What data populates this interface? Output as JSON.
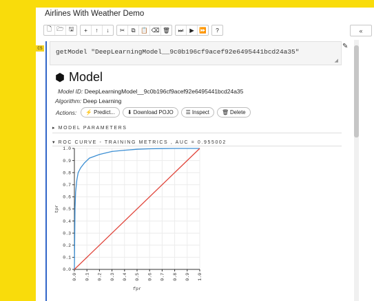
{
  "notebook": {
    "title": "Airlines With Weather Demo"
  },
  "toolbar": {
    "groups": [
      [
        "new-file-icon",
        "open-folder-icon",
        "save-icon"
      ],
      [
        "add-cell-icon",
        "move-up-icon",
        "move-down-icon"
      ],
      [
        "cut-icon",
        "copy-icon",
        "paste-icon",
        "clear-icon",
        "delete-icon"
      ],
      [
        "run-to-here-icon",
        "run-icon",
        "run-all-icon"
      ],
      [
        "help-icon"
      ]
    ],
    "glyphs": {
      "new-file-icon": "🗋",
      "open-folder-icon": "🗁",
      "save-icon": "🖫",
      "add-cell-icon": "+",
      "move-up-icon": "↑",
      "move-down-icon": "↓",
      "cut-icon": "✂",
      "copy-icon": "⧉",
      "paste-icon": "📋",
      "clear-icon": "⌫",
      "delete-icon": "🗑",
      "run-to-here-icon": "⏭",
      "run-icon": "▶",
      "run-all-icon": "⏩",
      "help-icon": "?"
    },
    "collapse_label": "«"
  },
  "cell": {
    "badge": "CS",
    "code": "getModel \"DeepLearningModel__9c0b196cf9acef92e6495441bcd24a35\""
  },
  "model": {
    "heading": "Model",
    "id_label": "Model ID:",
    "id_value": "DeepLearningModel__9c0b196cf9acef92e6495441bcd24a35",
    "algorithm_label": "Algorithm:",
    "algorithm_value": "Deep Learning",
    "actions_label": "Actions:",
    "actions": {
      "predict": "⚡ Predict...",
      "download_pojo": "⬇ Download POJO",
      "inspect": "☰ Inspect",
      "delete": "🗑 Delete"
    }
  },
  "sections": {
    "model_parameters": "▸ MODEL PARAMETERS",
    "roc_curve": "▾ ROC CURVE - TRAINING METRICS , AUC = 0.955002"
  },
  "chart_data": {
    "type": "line",
    "xlabel": "fpr",
    "ylabel": "tpr",
    "xlim": [
      0,
      1
    ],
    "ylim": [
      0,
      1
    ],
    "grid": true,
    "x_ticks": [
      "0.0",
      "0.1",
      "0.2",
      "0.3",
      "0.4",
      "0.5",
      "0.6",
      "0.7",
      "0.8",
      "0.9",
      "1.0"
    ],
    "y_ticks": [
      "0.0",
      "0.1",
      "0.2",
      "0.3",
      "0.4",
      "0.5",
      "0.6",
      "0.7",
      "0.8",
      "0.9",
      "1.0"
    ],
    "series": [
      {
        "color": "#3b8ed3",
        "x": [
          0,
          0.005,
          0.01,
          0.02,
          0.03,
          0.05,
          0.08,
          0.12,
          0.2,
          0.3,
          0.4,
          0.5,
          0.6,
          0.7,
          0.8,
          0.9,
          1.0
        ],
        "y": [
          0,
          0.5,
          0.64,
          0.74,
          0.8,
          0.84,
          0.88,
          0.92,
          0.95,
          0.975,
          0.985,
          0.993,
          0.997,
          0.999,
          1.0,
          1.0,
          1.0
        ]
      },
      {
        "color": "#e0443a",
        "x": [
          0,
          1
        ],
        "y": [
          0,
          1
        ]
      }
    ]
  }
}
